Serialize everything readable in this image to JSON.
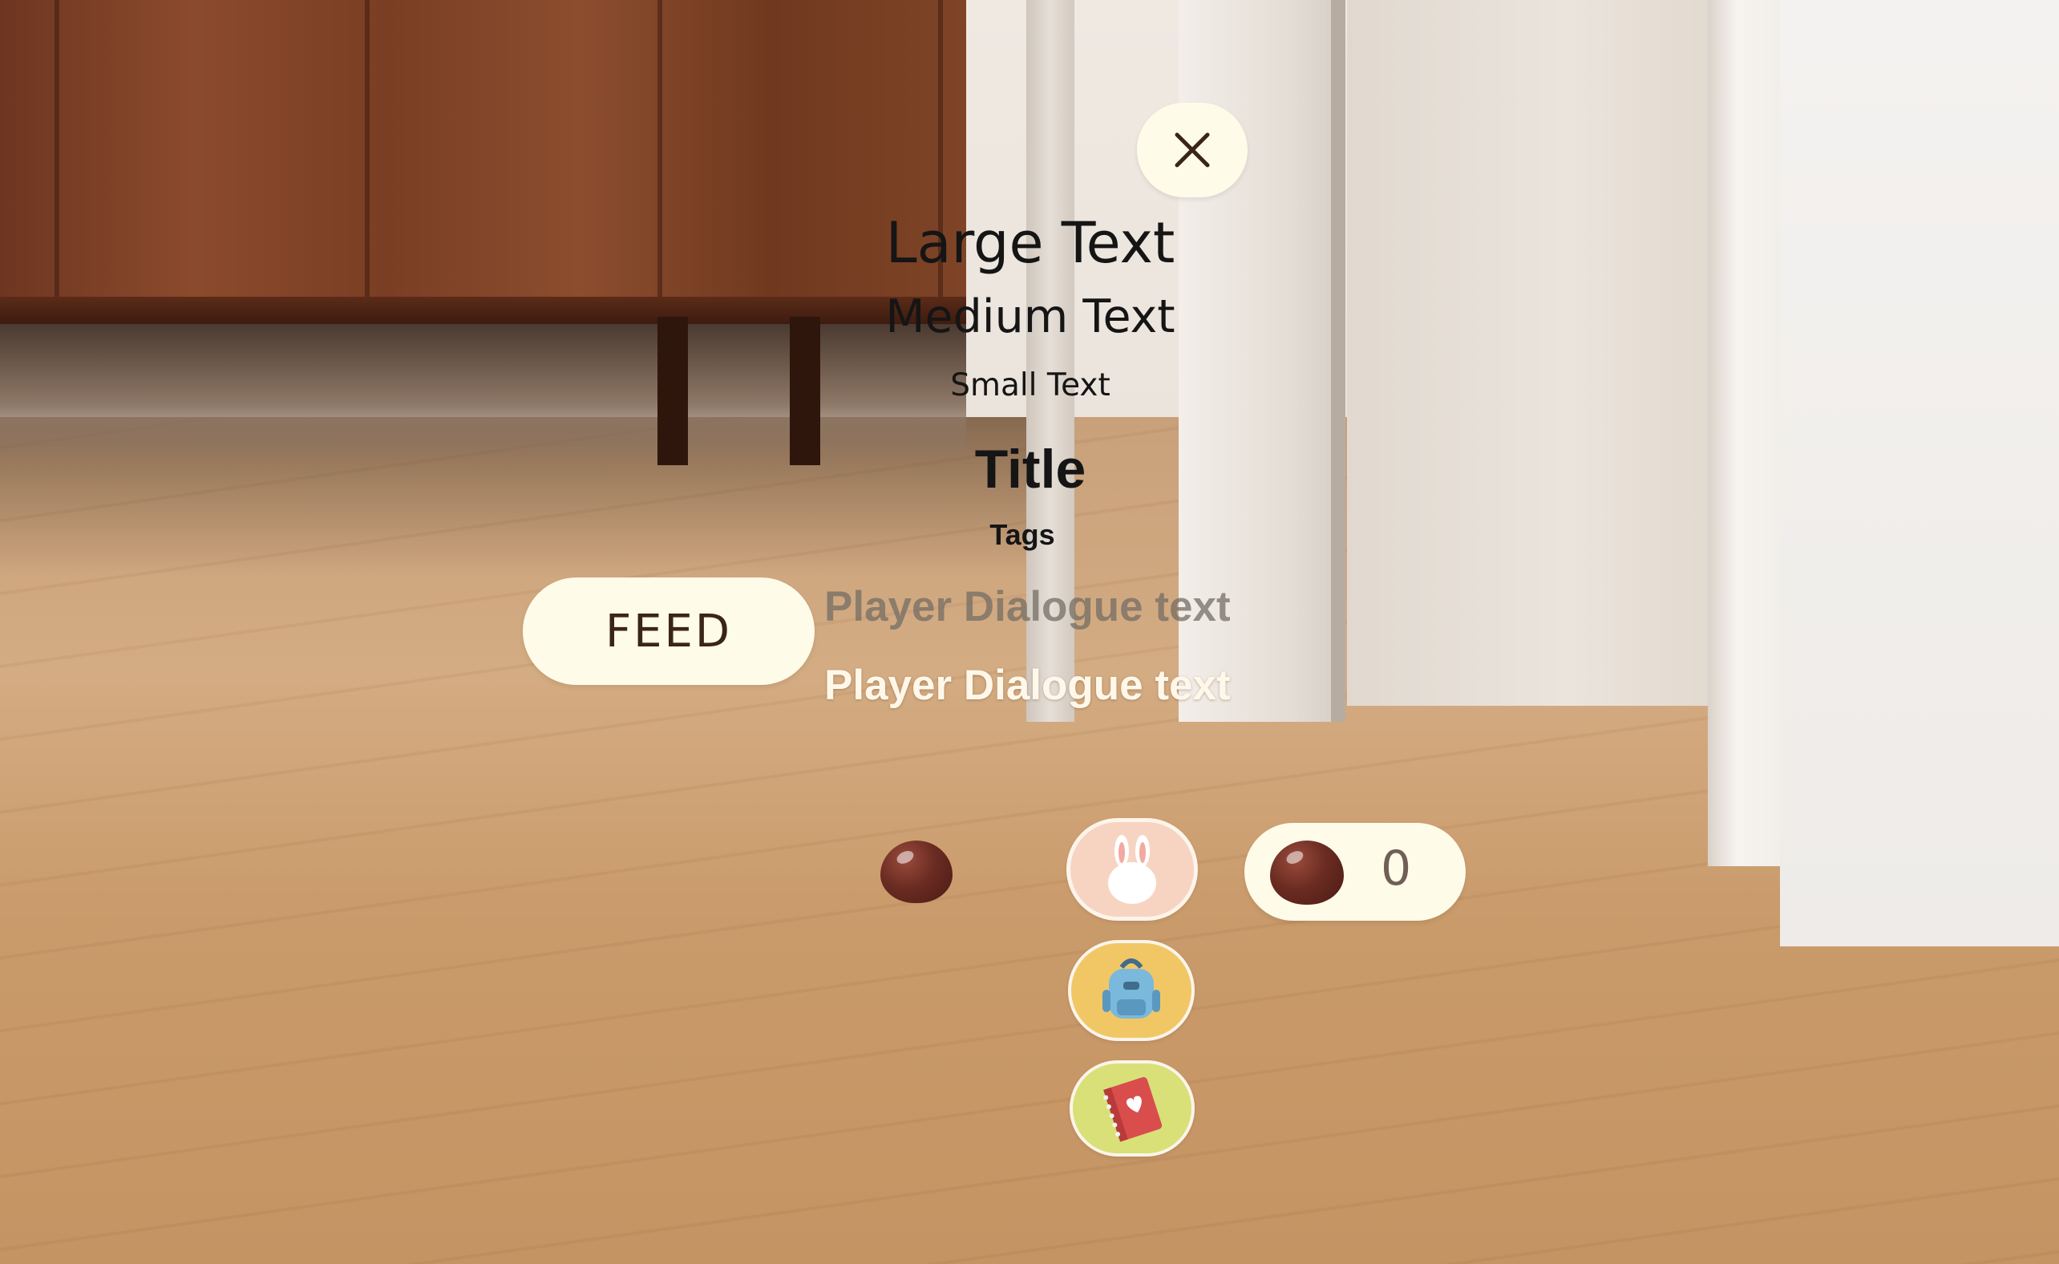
{
  "close_button": {
    "icon": "close-icon"
  },
  "text_samples": {
    "large": "Large Text",
    "medium": "Medium Text",
    "small": "Small Text",
    "title": "Title",
    "tags": "Tags"
  },
  "feed_button": {
    "label": "FEED"
  },
  "dialogue": {
    "faded": "Player Dialogue text",
    "active": "Player Dialogue text"
  },
  "hud": {
    "bean_count": "0",
    "buttons": [
      "bunny-icon",
      "backpack-icon",
      "notebook-icon"
    ]
  },
  "colors": {
    "panel": "#fffbe9",
    "bean": "#6b2c22",
    "bunny_bg": "#f7d4c2",
    "bag_bg": "#f1c766",
    "book_bg": "#d8e077"
  }
}
